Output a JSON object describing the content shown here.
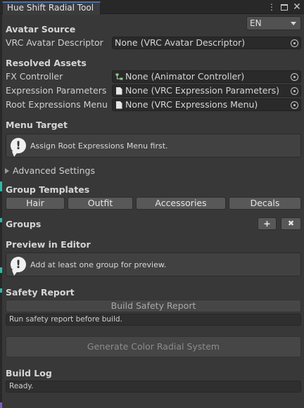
{
  "window": {
    "tab_title": "Hue Shift Radial Tool",
    "menu_icon": "kebab-menu-icon",
    "maximize_icon": "maximize-icon",
    "close_icon": "close-icon"
  },
  "language": {
    "selected": "EN"
  },
  "avatar_source": {
    "heading": "Avatar Source",
    "descriptor_label": "VRC Avatar Descriptor",
    "descriptor_value": "None (VRC Avatar Descriptor)"
  },
  "resolved_assets": {
    "heading": "Resolved Assets",
    "fx_label": "FX Controller",
    "fx_value": "None (Animator Controller)",
    "params_label": "Expression Parameters",
    "params_value": "None (VRC Expression Parameters)",
    "menu_label": "Root Expressions Menu",
    "menu_value": "None (VRC Expressions Menu)"
  },
  "menu_target": {
    "heading": "Menu Target",
    "help": "Assign Root Expressions Menu first."
  },
  "advanced": {
    "label": "Advanced Settings",
    "expanded": false
  },
  "group_templates": {
    "heading": "Group Templates",
    "buttons": [
      "Hair",
      "Outfit",
      "Accessories",
      "Decals"
    ]
  },
  "groups": {
    "heading": "Groups",
    "add": "+",
    "remove": "✖"
  },
  "preview": {
    "heading": "Preview in Editor",
    "help": "Add at least one group for preview."
  },
  "safety": {
    "heading": "Safety Report",
    "button": "Build Safety Report",
    "status": "Run safety report before build."
  },
  "generate": {
    "button": "Generate Color Radial System"
  },
  "build_log": {
    "heading": "Build Log",
    "status": "Ready."
  },
  "colors": {
    "accent": "#4d6ea8",
    "background": "#383838",
    "field": "#2a2a2a",
    "button": "#585858"
  }
}
